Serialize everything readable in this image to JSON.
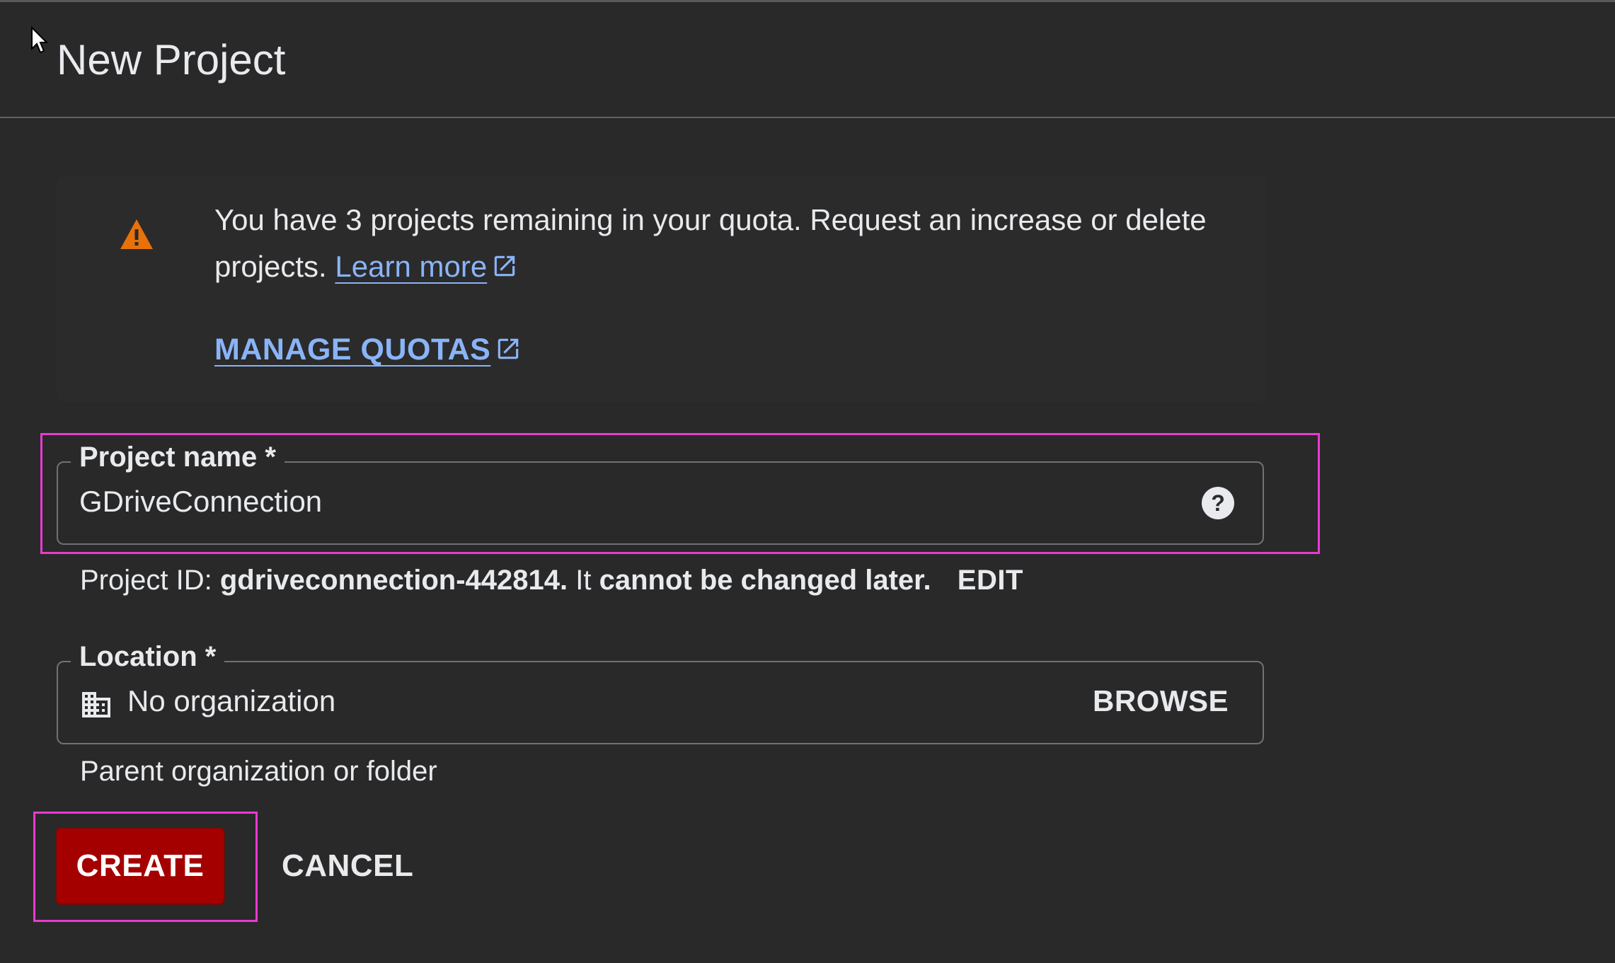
{
  "dialog": {
    "title": "New Project"
  },
  "quota_notice": {
    "icon": "warning-icon",
    "message": "You have 3 projects remaining in your quota. Request an increase or delete projects.",
    "learn_more_label": "Learn more",
    "manage_quotas_label": "MANAGE QUOTAS"
  },
  "project_name_field": {
    "label": "Project name *",
    "value": "GDriveConnection",
    "help_icon": "help-circle-icon"
  },
  "project_id_info": {
    "prefix": "Project ID:",
    "id": "gdriveconnection-442814.",
    "middle": "It",
    "suffix": "cannot be changed later.",
    "edit_label": "EDIT"
  },
  "location_field": {
    "label": "Location *",
    "icon": "building-icon",
    "value": "No organization",
    "browse_label": "BROWSE",
    "hint": "Parent organization or folder"
  },
  "actions": {
    "create_label": "CREATE",
    "cancel_label": "CANCEL"
  },
  "colors": {
    "background": "#292929",
    "link": "#8ab4f8",
    "warning": "#e8710a",
    "create_button": "#a40000",
    "highlight": "#e83bd1"
  }
}
